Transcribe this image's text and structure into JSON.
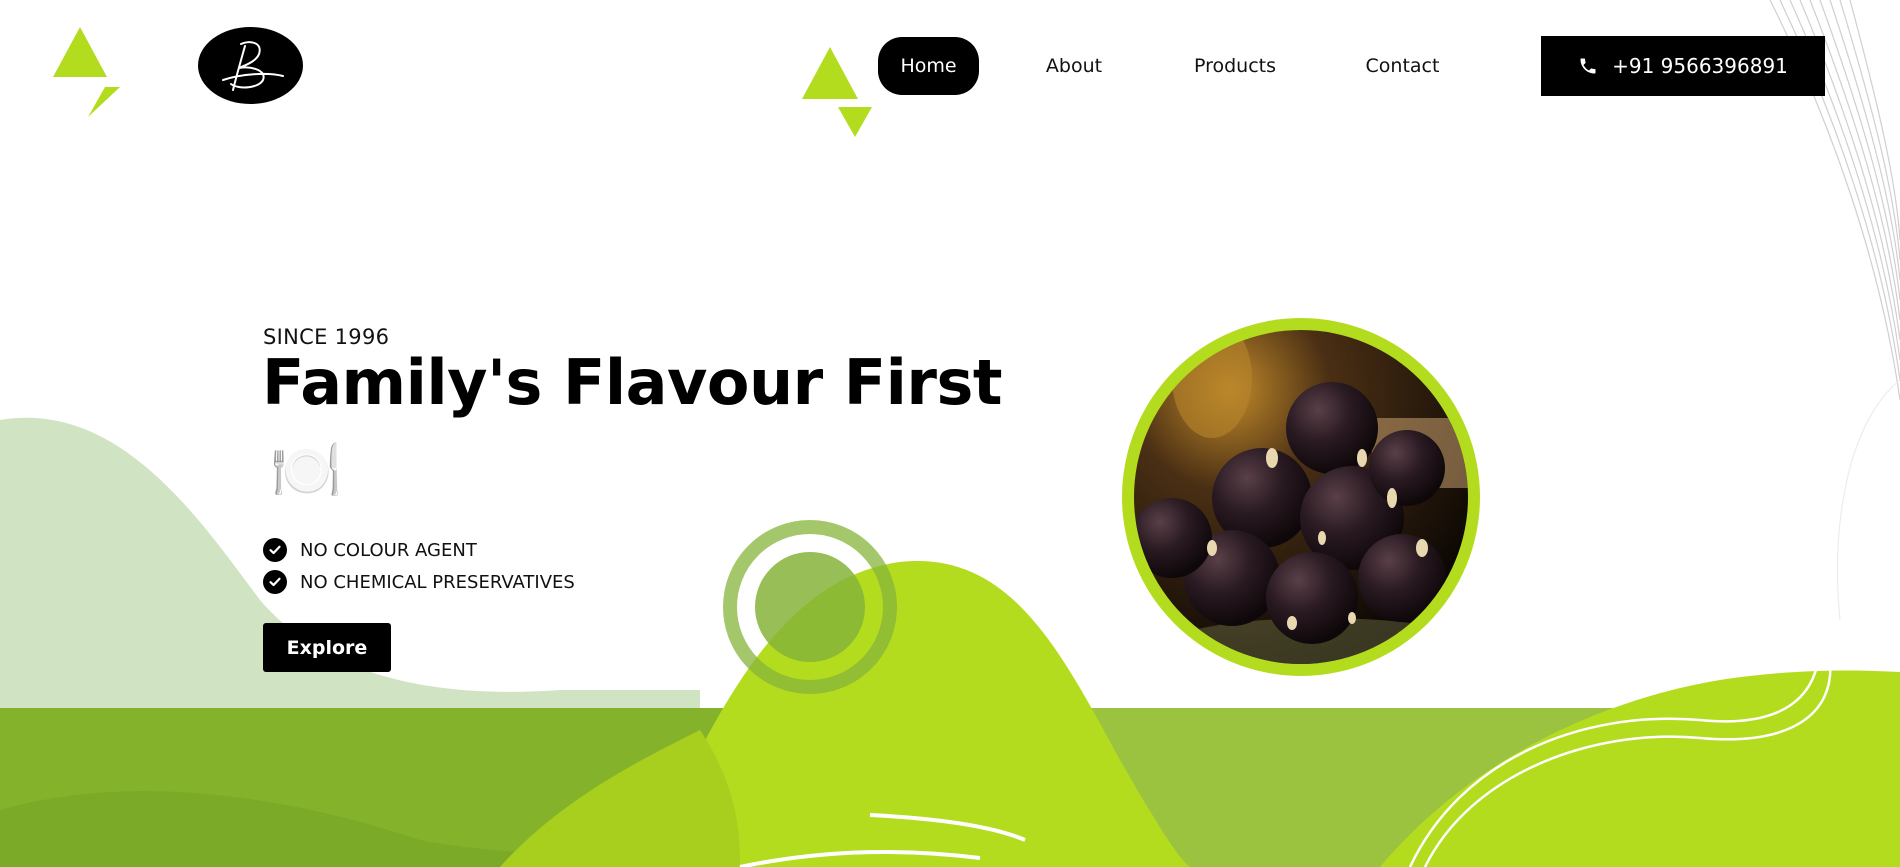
{
  "colors": {
    "lime": "#b4dc1e",
    "olive": "#84b22b",
    "pale_green": "#d0e4c4",
    "black": "#000000"
  },
  "header": {
    "logo_alt": "B",
    "nav": [
      {
        "label": "Home",
        "active": true
      },
      {
        "label": "About",
        "active": false
      },
      {
        "label": "Products",
        "active": false
      },
      {
        "label": "Contact",
        "active": false
      }
    ],
    "phone": {
      "icon": "phone-icon",
      "label": "+91 9566396891"
    }
  },
  "hero": {
    "eyebrow": "SINCE 1996",
    "title": "Family's Flavour First",
    "emoji": "🍽️",
    "features": [
      {
        "icon": "check-circle-icon",
        "label": "NO COLOUR AGENT"
      },
      {
        "icon": "check-circle-icon",
        "label": "NO CHEMICAL PRESERVATIVES"
      }
    ],
    "cta_label": "Explore",
    "image": "chocolate-laddu-photo"
  }
}
